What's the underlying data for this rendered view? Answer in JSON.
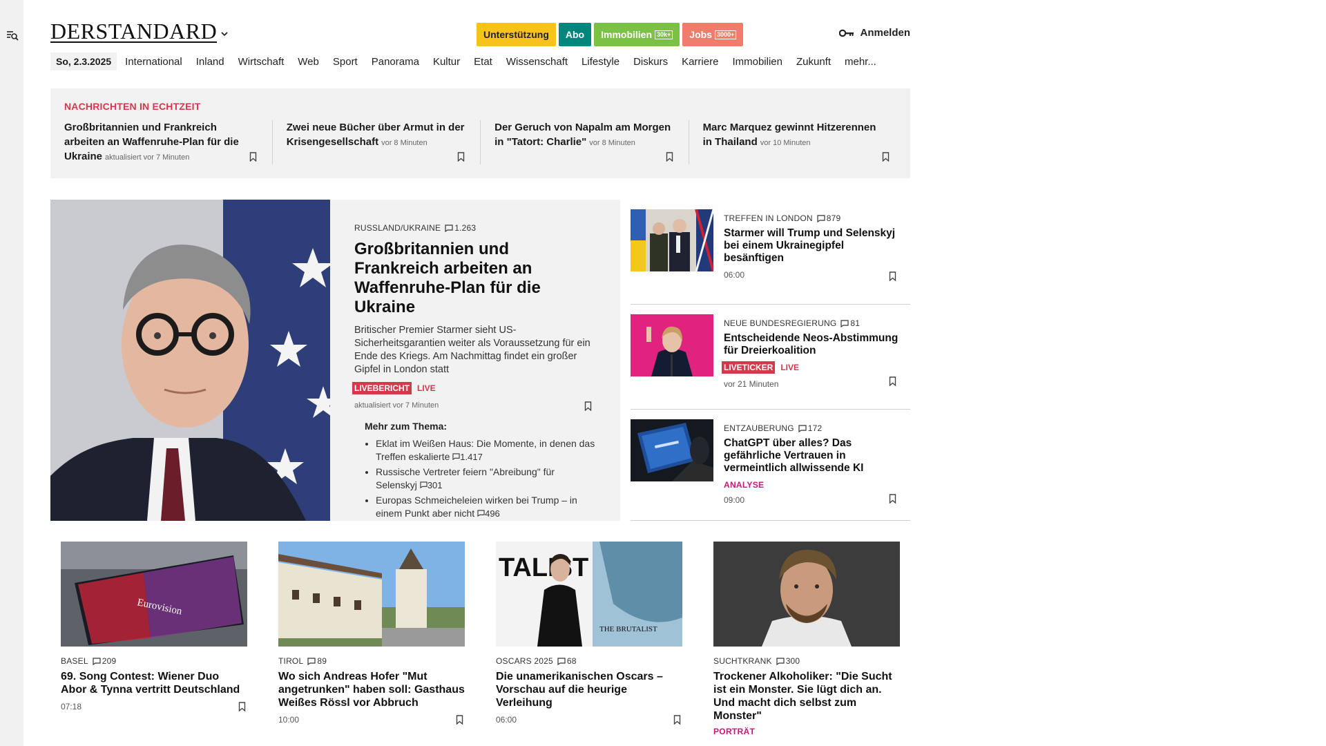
{
  "header": {
    "logo": "DERSTANDARD",
    "pills": {
      "support": "Unterstützung",
      "abo": "Abo",
      "immobilien": "Immobilien",
      "immobilien_badge": "30k+",
      "jobs": "Jobs",
      "jobs_badge": "3000+"
    },
    "login": "Anmelden"
  },
  "nav": {
    "date": "So, 2.3.2025",
    "items": [
      "International",
      "Inland",
      "Wirtschaft",
      "Web",
      "Sport",
      "Panorama",
      "Kultur",
      "Etat",
      "Wissenschaft",
      "Lifestyle",
      "Diskurs",
      "Karriere",
      "Immobilien",
      "Zukunft",
      "mehr..."
    ]
  },
  "ticker": {
    "title": "NACHRICHTEN IN ECHTZEIT",
    "items": [
      {
        "headline": "Großbritannien und Frankreich arbeiten an Waffenruhe-Plan für die Ukraine",
        "time": "aktualisiert vor 7 Minuten"
      },
      {
        "headline": "Zwei neue Bücher über Armut in der Krisengesellschaft",
        "time": "vor 8 Minuten"
      },
      {
        "headline": "Der Geruch von Napalm am Morgen in \"Tatort: Charlie\"",
        "time": "vor 8 Minuten"
      },
      {
        "headline": "Marc Marquez gewinnt Hitzerennen in Thailand",
        "time": "vor 10 Minuten"
      }
    ]
  },
  "hero": {
    "kicker": "RUSSLAND/UKRAINE",
    "comments": "1.263",
    "title": "Großbritannien und Frankreich arbeiten an Waffenruhe-Plan für die Ukraine",
    "lead": "Britischer Premier Starmer sieht US-Sicherheitsgarantien weiter als Voraussetzung für ein Ende des Kriegs. Am Nachmittag findet ein großer Gipfel in London statt",
    "tag": "LIVEBERICHT",
    "live": "LIVE",
    "updated": "aktualisiert vor 7 Minuten",
    "more_title": "Mehr zum Thema:",
    "more": [
      {
        "text": "Eklat im Weißen Haus: Die Momente, in denen das Treffen eskalierte",
        "comments": "1.417"
      },
      {
        "text": "Russische Vertreter feiern \"Abreibung\" für Selenskyj",
        "comments": "301"
      },
      {
        "text": "Europas Schmeicheleien wirken bei Trump – in einem Punkt aber nicht",
        "comments": "496"
      }
    ]
  },
  "right": [
    {
      "kicker": "TREFFEN IN LONDON",
      "comments": "879",
      "title": "Starmer will Trump und Selenskyj bei einem Ukrainegipfel besänftigen",
      "time": "06:00"
    },
    {
      "kicker": "NEUE BUNDESREGIERUNG",
      "comments": "81",
      "title": "Entscheidende Neos-Abstimmung für Dreierkoalition",
      "tag": "LIVETICKER",
      "live": "LIVE",
      "time": "vor 21 Minuten"
    },
    {
      "kicker": "ENTZAUBERUNG",
      "comments": "172",
      "title": "ChatGPT über alles? Das gefährliche Vertrauen in vermeintlich allwissende KI",
      "label": "ANALYSE",
      "time": "09:00"
    }
  ],
  "cards": [
    {
      "kicker": "BASEL",
      "comments": "209",
      "title": "69. Song Contest: Wiener Duo Abor & Tynna vertritt Deutschland",
      "time": "07:18",
      "image_text": "Eurovision"
    },
    {
      "kicker": "TIROL",
      "comments": "89",
      "title": "Wo sich Andreas Hofer \"Mut angetrunken\" haben soll: Gasthaus Weißes Rössl vor Abbruch",
      "time": "10:00"
    },
    {
      "kicker": "OSCARS 2025",
      "comments": "68",
      "title": "Die unamerikanischen Oscars – Vorschau auf die heurige Verleihung",
      "time": "06:00",
      "image_text": "TALIST",
      "image_text2": "THE BRUTALIST"
    },
    {
      "kicker": "SUCHTKRANK",
      "comments": "300",
      "title": "Trockener Alkoholiker: \"Die Sucht ist ein Monster. Sie lügt dich an. Und macht dich selbst zum Monster\"",
      "label": "PORTRÄT"
    }
  ],
  "colors": {
    "accent_red": "#d23a4c",
    "accent_magenta": "#d1117b",
    "panel_bg": "#f2f2f2"
  }
}
